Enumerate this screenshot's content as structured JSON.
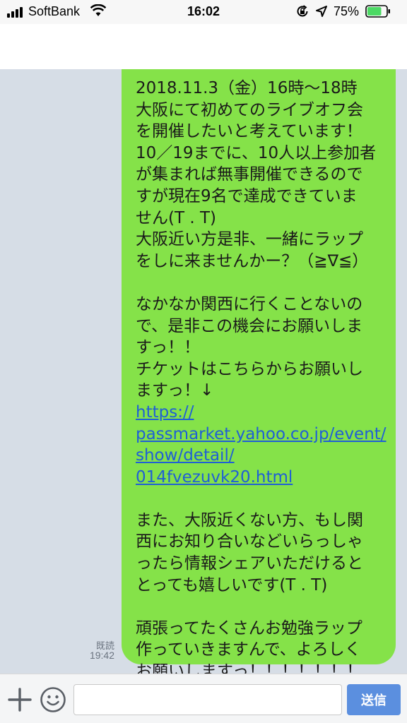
{
  "status_bar": {
    "carrier": "SoftBank",
    "time": "16:02",
    "battery_percent": "75%",
    "battery_level": 0.75,
    "battery_color": "#4cd964",
    "icons": [
      "signal-bars-icon",
      "wifi-icon",
      "rotation-lock-icon",
      "location-arrow-icon",
      "battery-icon"
    ]
  },
  "chat": {
    "bubble_color": "#85e249",
    "link_color": "#1f5fd6",
    "message_lines": [
      {
        "text": "2018.11.3（金）16時〜18時",
        "link": false
      },
      {
        "text": "大阪にて初めてのライブオフ会",
        "link": false
      },
      {
        "text": "を開催したいと考えています！",
        "link": false
      },
      {
        "text": "10／19までに、10人以上参加者",
        "link": false
      },
      {
        "text": "が集まれば無事開催できるので",
        "link": false
      },
      {
        "text": "すが現在9名で達成できていま",
        "link": false
      },
      {
        "text": "せん(T . T)",
        "link": false
      },
      {
        "text": "大阪近い方是非、一緒にラップ",
        "link": false
      },
      {
        "text": "をしに来ませんかー？（≧∇≦）",
        "link": false
      },
      {
        "text": "",
        "link": false
      },
      {
        "text": "なかなか関西に行くことないの",
        "link": false
      },
      {
        "text": "で、是非この機会にお願いしま",
        "link": false
      },
      {
        "text": "すっ！！",
        "link": false
      },
      {
        "text": "チケットはこちらからお願いし",
        "link": false
      },
      {
        "text": "ますっ！↓",
        "link": false
      },
      {
        "text": "https://",
        "link": true
      },
      {
        "text": "passmarket.yahoo.co.jp/event/",
        "link": true
      },
      {
        "text": "show/detail/",
        "link": true
      },
      {
        "text": "014fvezuvk20.html",
        "link": true
      },
      {
        "text": "",
        "link": false
      },
      {
        "text": "また、大阪近くない方、もし関",
        "link": false
      },
      {
        "text": "西にお知り合いなどいらっしゃ",
        "link": false
      },
      {
        "text": "ったら情報シェアいただけると",
        "link": false
      },
      {
        "text": "とっても嬉しいです(T . T)",
        "link": false
      },
      {
        "text": "",
        "link": false
      },
      {
        "text": "頑張ってたくさんお勉強ラップ",
        "link": false
      },
      {
        "text": "作っていきますんで、よろしく",
        "link": false
      },
      {
        "text": "お願いしますっ！！！！！！！",
        "link": false
      }
    ],
    "read_label": "既読",
    "sent_time": "19:42"
  },
  "input_bar": {
    "message_value": "",
    "send_label": "送信",
    "send_color": "#5b8fdf",
    "icons": [
      "plus-icon",
      "smile-icon"
    ]
  }
}
